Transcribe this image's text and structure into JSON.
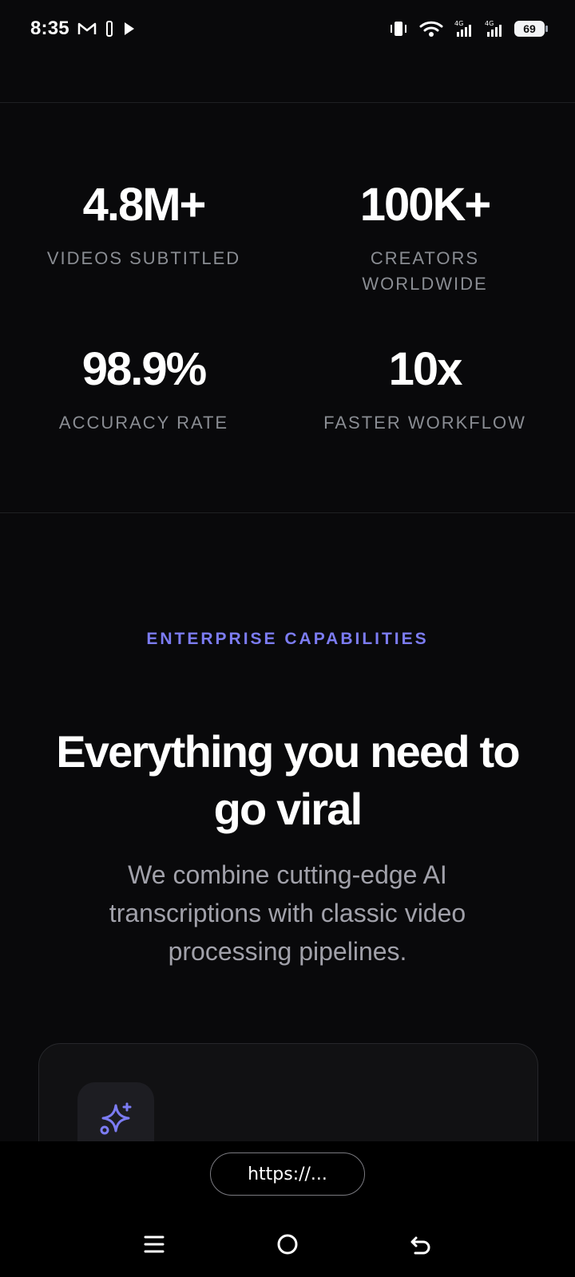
{
  "status_bar": {
    "time": "8:35",
    "battery_level": "69",
    "icons": [
      "gmail-icon",
      "bluetooth-file-icon",
      "play-icon",
      "vibrate-icon",
      "wifi-icon",
      "signal-4g-icon",
      "signal-4g-icon"
    ]
  },
  "stats": [
    {
      "value": "4.8M+",
      "label": "VIDEOS SUBTITLED"
    },
    {
      "value": "100K+",
      "label": "CREATORS WORLDWIDE"
    },
    {
      "value": "98.9%",
      "label": "ACCURACY RATE"
    },
    {
      "value": "10x",
      "label": "FASTER WORKFLOW"
    }
  ],
  "capabilities": {
    "eyebrow": "ENTERPRISE CAPABILITIES",
    "headline": "Everything you need to go viral",
    "description": "We combine cutting-edge AI transcriptions with classic video processing pipelines."
  },
  "browser": {
    "url_label": "https://..."
  },
  "colors": {
    "background": "#09090b",
    "accent": "#7c7cf3",
    "muted_text": "#8a8d93"
  }
}
